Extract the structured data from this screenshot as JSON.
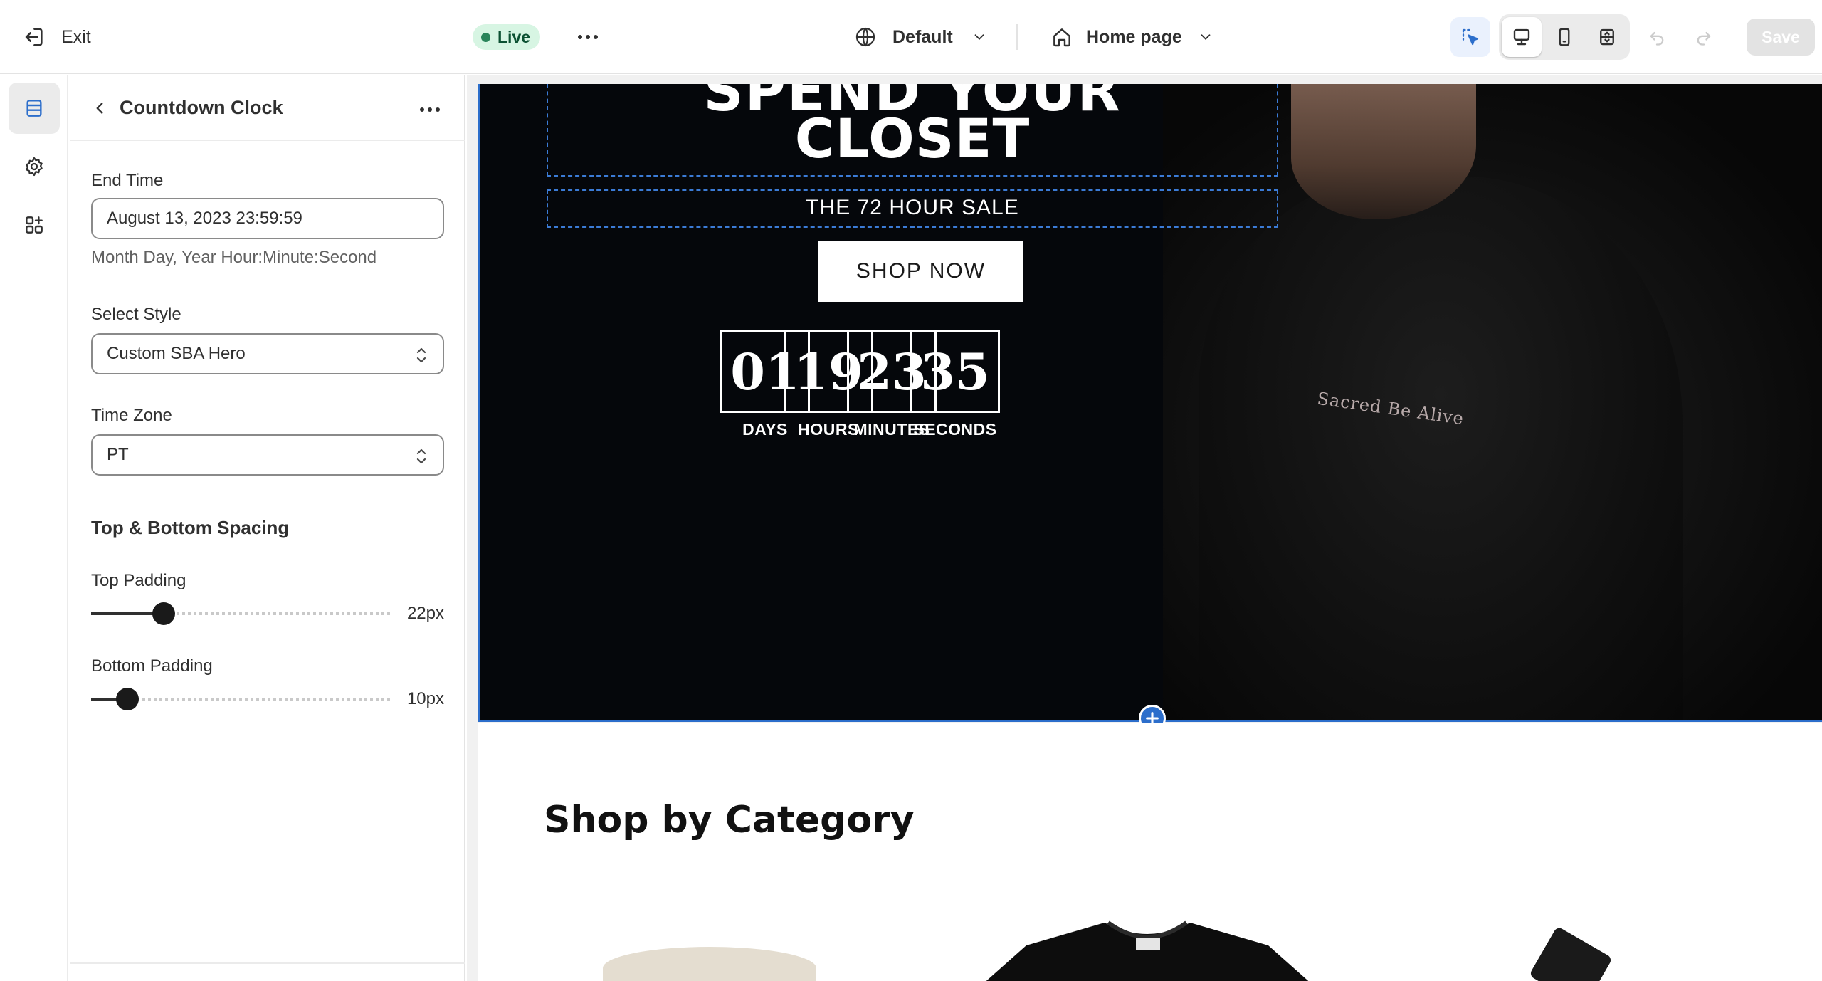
{
  "topbar": {
    "exit_label": "Exit",
    "live_label": "Live",
    "theme_label": "Default",
    "page_label": "Home page",
    "save_label": "Save"
  },
  "panel": {
    "title": "Countdown Clock",
    "end_time": {
      "label": "End Time",
      "value": "August 13, 2023 23:59:59",
      "help": "Month Day, Year Hour:Minute:Second"
    },
    "select_style": {
      "label": "Select Style",
      "value": "Custom SBA Hero"
    },
    "time_zone": {
      "label": "Time Zone",
      "value": "PT"
    },
    "spacing_heading": "Top & Bottom Spacing",
    "top_padding": {
      "label": "Top Padding",
      "value_text": "22px",
      "fraction": 0.24
    },
    "bottom_padding": {
      "label": "Bottom Padding",
      "value_text": "10px",
      "fraction": 0.12
    }
  },
  "preview": {
    "hero_title_top": "SPEND YOUR",
    "hero_title": "CLOSET",
    "hero_subtitle": "THE 72 HOUR SALE",
    "shop_button": "SHOP NOW",
    "hero_logo_text": "Sacred Be Alive",
    "countdown": [
      {
        "value": "01",
        "label": "DAYS"
      },
      {
        "value": "19",
        "label": "HOURS"
      },
      {
        "value": "23",
        "label": "MINUTES"
      },
      {
        "value": "35",
        "label": "SECONDS"
      }
    ],
    "category_title": "Shop by Category"
  },
  "colors": {
    "accent": "#2c6ecb",
    "live_bg": "#d7f5e3",
    "hero_bg": "#05070b"
  },
  "icons": {
    "exit": "exit-icon",
    "more": "more-horizontal-icon",
    "globe": "globe-icon",
    "home": "home-icon",
    "inspector": "cursor-select-icon",
    "desktop": "desktop-icon",
    "mobile": "mobile-icon",
    "fullscreen": "fullscreen-icon",
    "undo": "undo-icon",
    "redo": "redo-icon",
    "sections": "sections-icon",
    "settings": "gear-icon",
    "apps": "apps-icon",
    "back": "chevron-left-icon",
    "select": "select-arrows-icon",
    "add": "plus-circle-icon"
  }
}
